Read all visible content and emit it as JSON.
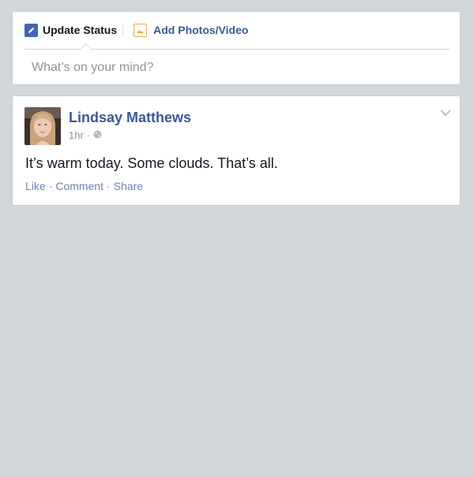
{
  "composer": {
    "update_status_label": "Update Status",
    "add_photos_label": "Add Photos/Video",
    "placeholder": "What’s on your mind?"
  },
  "post": {
    "author": "Lindsay Matthews",
    "time": "1hr",
    "meta_separator": "·",
    "privacy_icon": "globe-icon",
    "text": "It’s warm today. Some clouds. That’s all.",
    "actions": {
      "like": "Like",
      "comment": "Comment",
      "share": "Share",
      "separator": "·"
    }
  },
  "colors": {
    "background": "#d3d6db",
    "link": "#3b5998",
    "action_link": "#6c84b4",
    "meta": "#90949c",
    "text": "#141823"
  }
}
